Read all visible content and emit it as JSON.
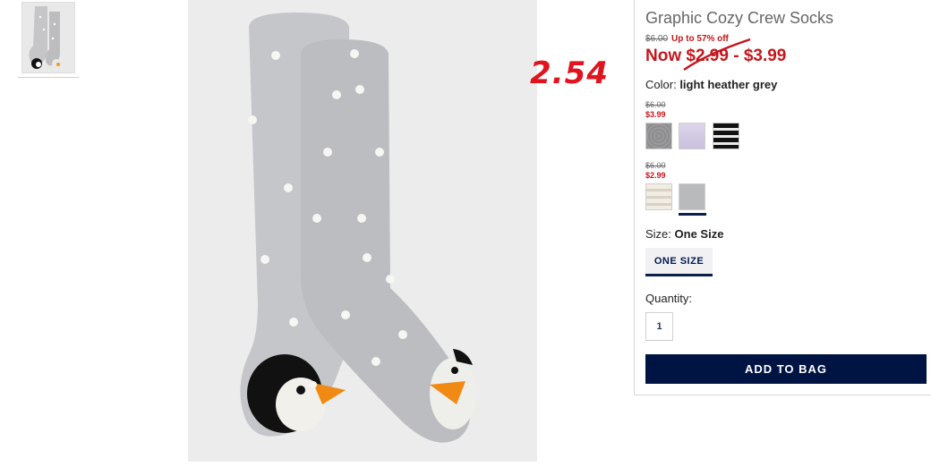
{
  "product": {
    "title": "Graphic Cozy Crew Socks",
    "original_price": "$6.00",
    "discount_text": "Up to 57% off",
    "now_price": "Now $2.99 - $3.99"
  },
  "annotation": {
    "value": "2.54",
    "color": "#e0141e"
  },
  "color_selector": {
    "label": "Color:",
    "selected": "light heather grey",
    "groups": [
      {
        "old_price": "$6.00",
        "new_price": "$3.99",
        "swatches": [
          "grey-dot-swatch",
          "lilac-swatch",
          "black-white-stripe-swatch"
        ]
      },
      {
        "old_price": "$6.00",
        "new_price": "$2.99",
        "swatches": [
          "cream-stripe-swatch",
          "light-heather-grey-swatch"
        ]
      }
    ]
  },
  "size_selector": {
    "label": "Size:",
    "selected": "One Size",
    "button_label": "ONE SIZE"
  },
  "quantity": {
    "label": "Quantity:",
    "value": "1"
  },
  "actions": {
    "add_to_bag": "ADD TO BAG"
  },
  "colors": {
    "accent_navy": "#001443",
    "sale_red": "#c4161c"
  }
}
